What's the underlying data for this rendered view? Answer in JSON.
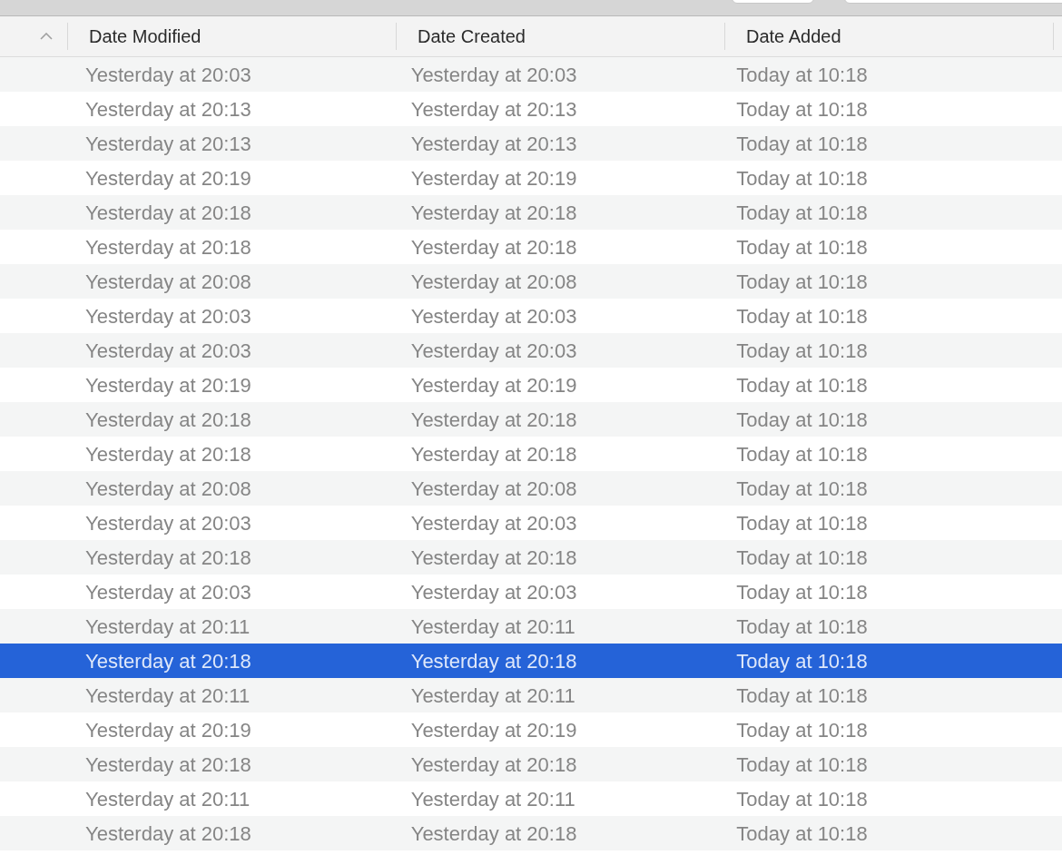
{
  "table": {
    "columns": [
      {
        "label": "Date Modified"
      },
      {
        "label": "Date Created"
      },
      {
        "label": "Date Added"
      }
    ],
    "rows": [
      {
        "modified": "Yesterday at 20:03",
        "created": "Yesterday at 20:03",
        "added": "Today at 10:18",
        "selected": false
      },
      {
        "modified": "Yesterday at 20:13",
        "created": "Yesterday at 20:13",
        "added": "Today at 10:18",
        "selected": false
      },
      {
        "modified": "Yesterday at 20:13",
        "created": "Yesterday at 20:13",
        "added": "Today at 10:18",
        "selected": false
      },
      {
        "modified": "Yesterday at 20:19",
        "created": "Yesterday at 20:19",
        "added": "Today at 10:18",
        "selected": false
      },
      {
        "modified": "Yesterday at 20:18",
        "created": "Yesterday at 20:18",
        "added": "Today at 10:18",
        "selected": false
      },
      {
        "modified": "Yesterday at 20:18",
        "created": "Yesterday at 20:18",
        "added": "Today at 10:18",
        "selected": false
      },
      {
        "modified": "Yesterday at 20:08",
        "created": "Yesterday at 20:08",
        "added": "Today at 10:18",
        "selected": false
      },
      {
        "modified": "Yesterday at 20:03",
        "created": "Yesterday at 20:03",
        "added": "Today at 10:18",
        "selected": false
      },
      {
        "modified": "Yesterday at 20:03",
        "created": "Yesterday at 20:03",
        "added": "Today at 10:18",
        "selected": false
      },
      {
        "modified": "Yesterday at 20:19",
        "created": "Yesterday at 20:19",
        "added": "Today at 10:18",
        "selected": false
      },
      {
        "modified": "Yesterday at 20:18",
        "created": "Yesterday at 20:18",
        "added": "Today at 10:18",
        "selected": false
      },
      {
        "modified": "Yesterday at 20:18",
        "created": "Yesterday at 20:18",
        "added": "Today at 10:18",
        "selected": false
      },
      {
        "modified": "Yesterday at 20:08",
        "created": "Yesterday at 20:08",
        "added": "Today at 10:18",
        "selected": false
      },
      {
        "modified": "Yesterday at 20:03",
        "created": "Yesterday at 20:03",
        "added": "Today at 10:18",
        "selected": false
      },
      {
        "modified": "Yesterday at 20:18",
        "created": "Yesterday at 20:18",
        "added": "Today at 10:18",
        "selected": false
      },
      {
        "modified": "Yesterday at 20:03",
        "created": "Yesterday at 20:03",
        "added": "Today at 10:18",
        "selected": false
      },
      {
        "modified": "Yesterday at 20:11",
        "created": "Yesterday at 20:11",
        "added": "Today at 10:18",
        "selected": false
      },
      {
        "modified": "Yesterday at 20:18",
        "created": "Yesterday at 20:18",
        "added": "Today at 10:18",
        "selected": true
      },
      {
        "modified": "Yesterday at 20:11",
        "created": "Yesterday at 20:11",
        "added": "Today at 10:18",
        "selected": false
      },
      {
        "modified": "Yesterday at 20:19",
        "created": "Yesterday at 20:19",
        "added": "Today at 10:18",
        "selected": false
      },
      {
        "modified": "Yesterday at 20:18",
        "created": "Yesterday at 20:18",
        "added": "Today at 10:18",
        "selected": false
      },
      {
        "modified": "Yesterday at 20:11",
        "created": "Yesterday at 20:11",
        "added": "Today at 10:18",
        "selected": false
      },
      {
        "modified": "Yesterday at 20:18",
        "created": "Yesterday at 20:18",
        "added": "Today at 10:18",
        "selected": false
      }
    ]
  }
}
